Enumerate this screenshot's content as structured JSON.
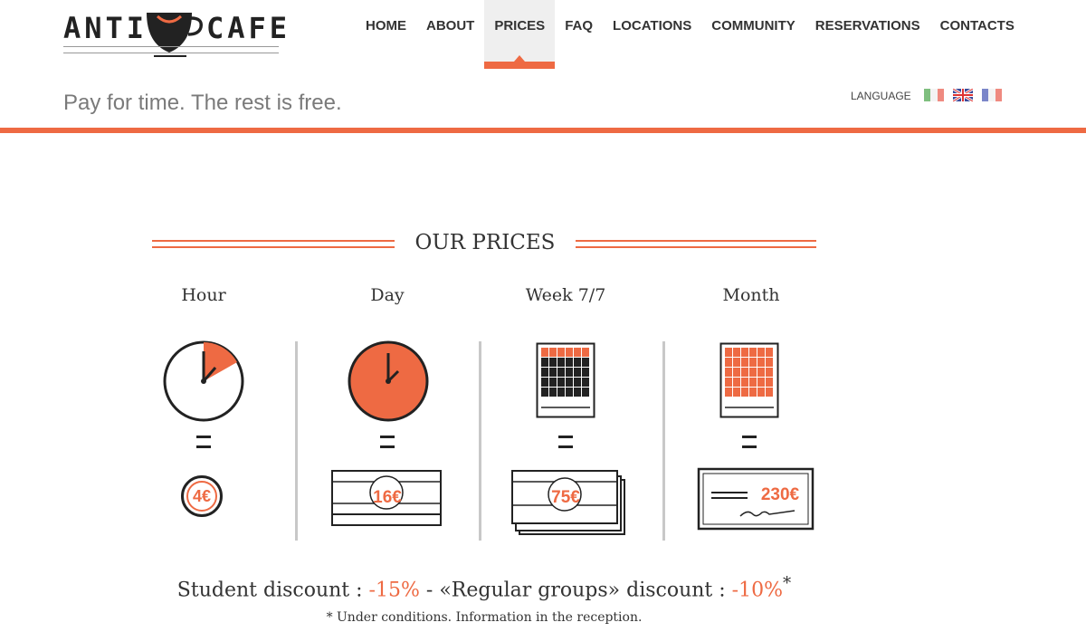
{
  "logo": {
    "left_text": "ANTI",
    "right_text": "CAFE"
  },
  "nav": {
    "items": [
      "HOME",
      "ABOUT",
      "PRICES",
      "FAQ",
      "LOCATIONS",
      "COMMUNITY",
      "RESERVATIONS",
      "CONTACTS"
    ],
    "active": "PRICES"
  },
  "tagline": "Pay for time. The rest is free.",
  "language": {
    "label": "LANGUAGE",
    "flags": [
      "italian-flag-icon",
      "uk-flag-icon",
      "french-flag-icon"
    ]
  },
  "colors": {
    "accent": "#ee6a43",
    "dark": "#222222",
    "muted": "#7a7a7a"
  },
  "prices": {
    "title": "OUR PRICES",
    "plans": [
      {
        "label": "Hour",
        "price": "4€",
        "icon": "clock-quarter-icon"
      },
      {
        "label": "Day",
        "price": "16€",
        "icon": "clock-full-icon"
      },
      {
        "label": "Week 7/7",
        "price": "75€",
        "icon": "calendar-week-icon"
      },
      {
        "label": "Month",
        "price": "230€",
        "icon": "calendar-month-icon"
      }
    ]
  },
  "discount": {
    "student_label": "Student discount : ",
    "student_value": "-15%",
    "separator": " - ",
    "groups_label": "«Regular groups» discount : ",
    "groups_value": "-10%",
    "asterisk": "*"
  },
  "footnote": "* Under conditions. Information in the reception."
}
